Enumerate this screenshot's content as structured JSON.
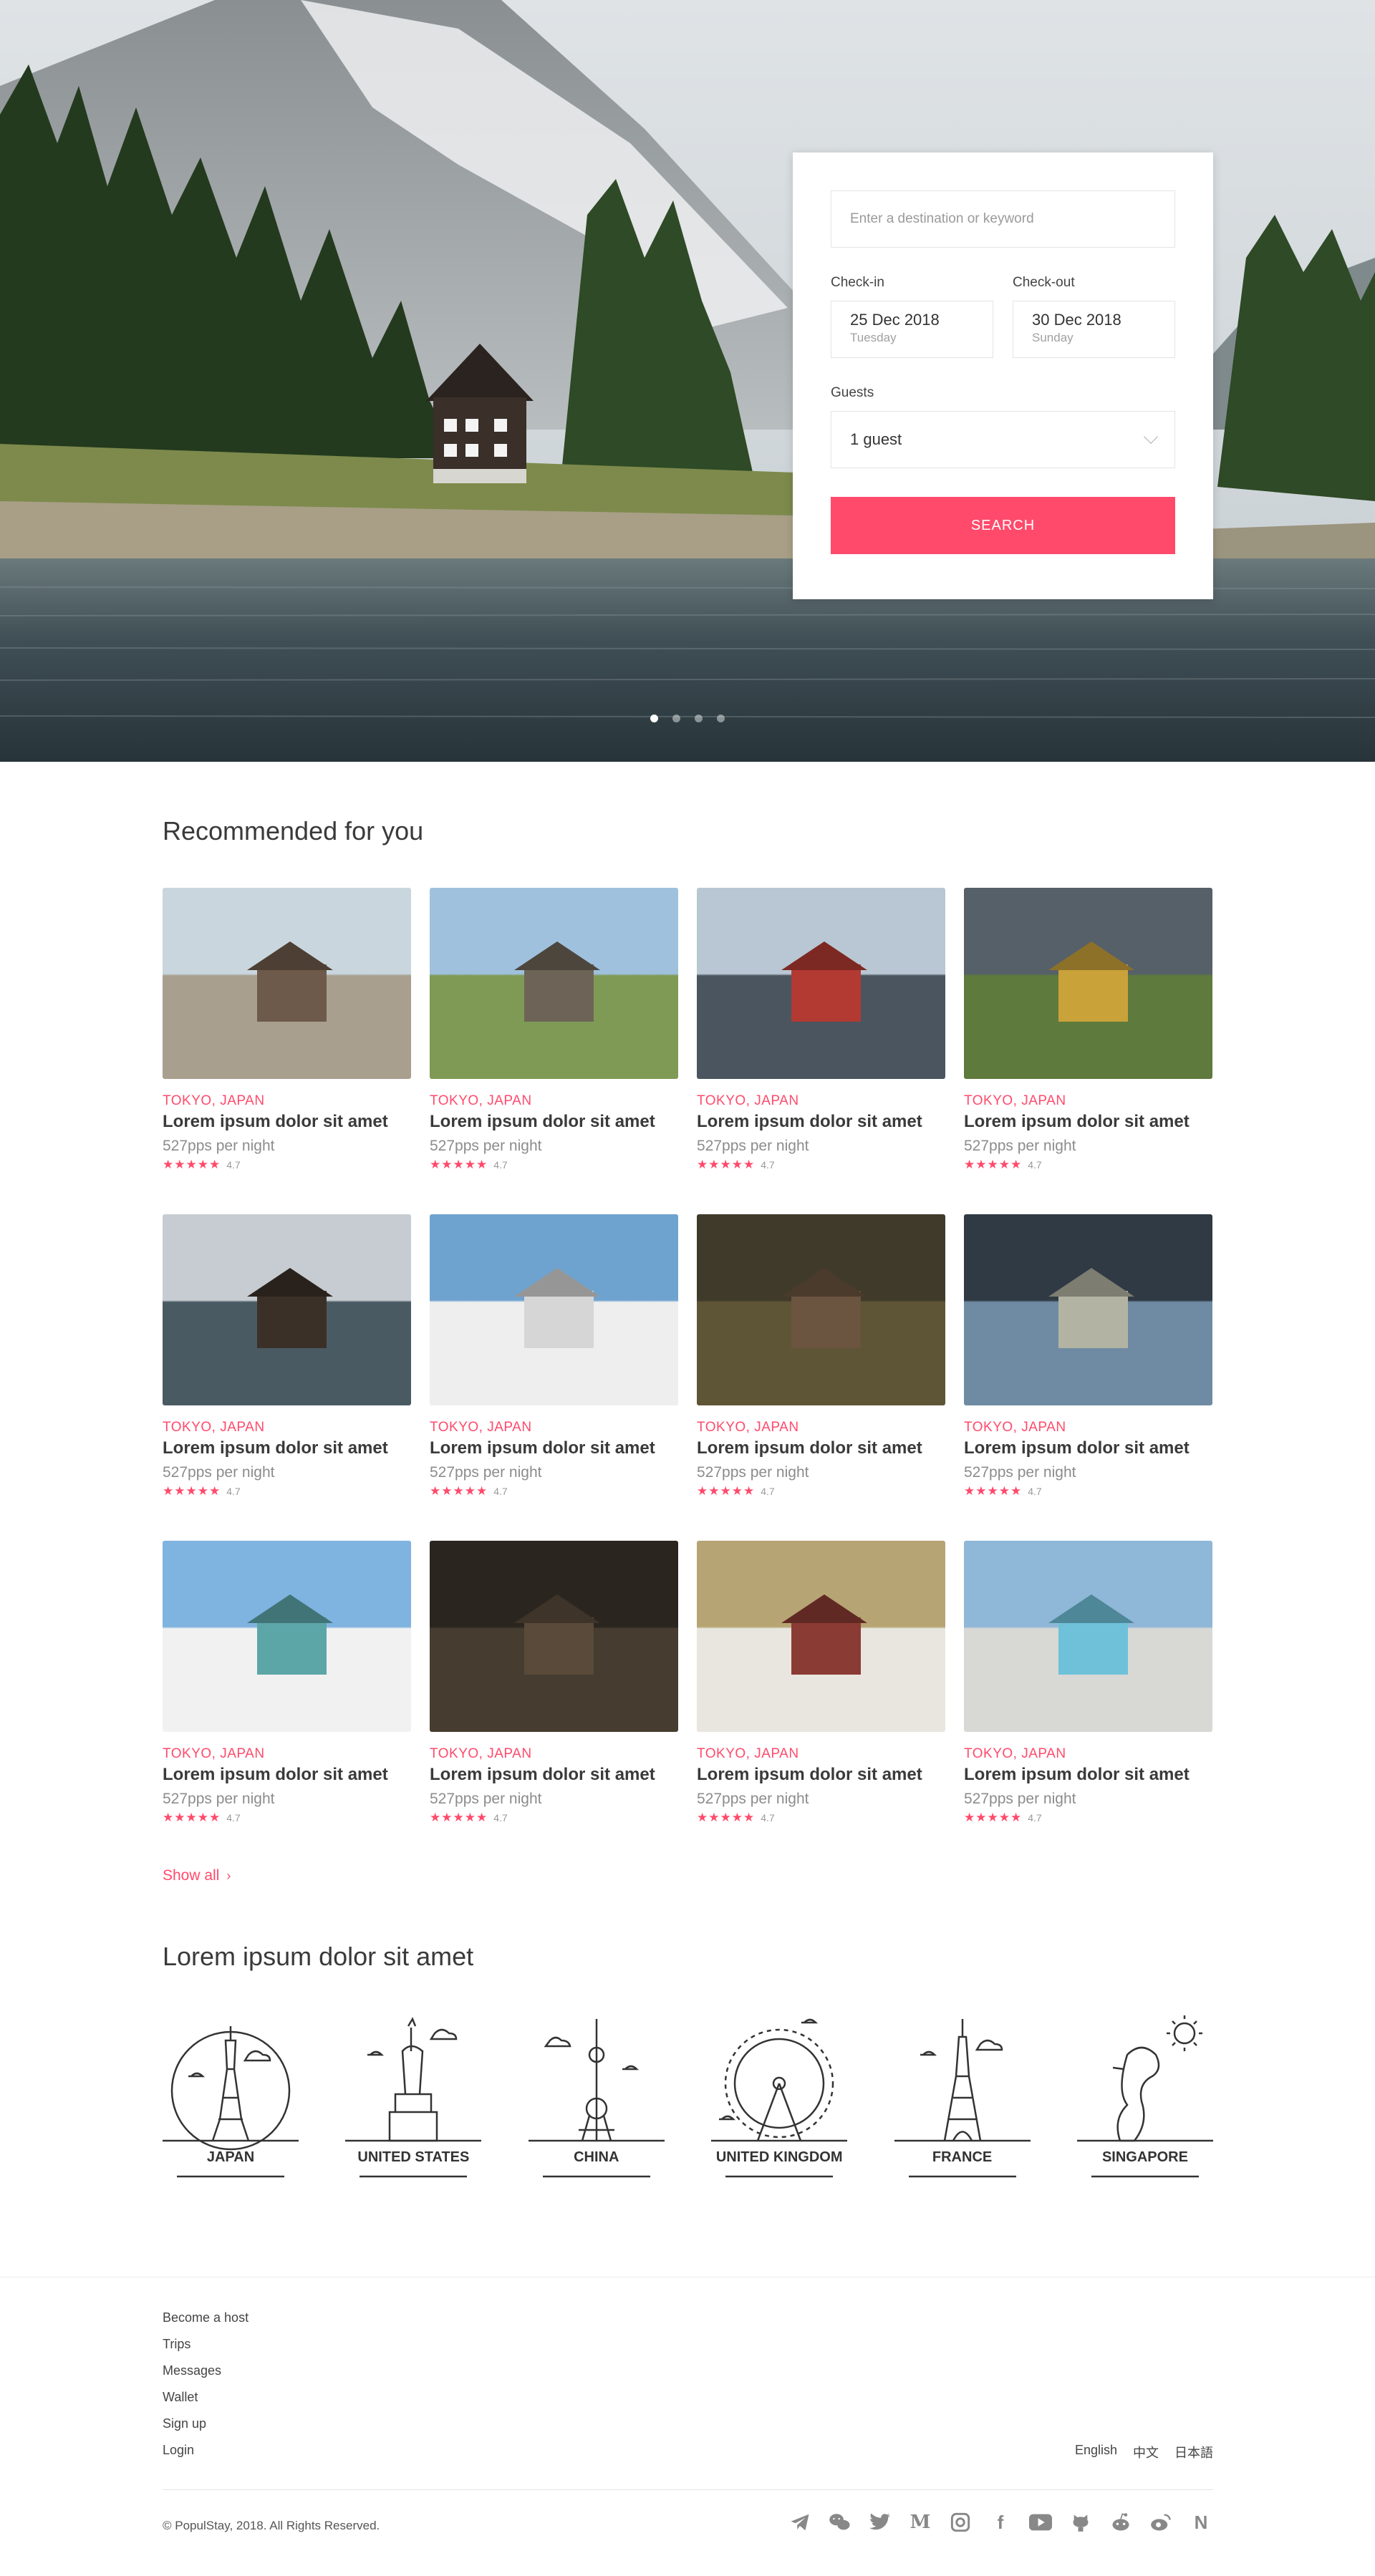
{
  "hero": {
    "carousel": {
      "slides": 4,
      "active": 1
    }
  },
  "search": {
    "destination_placeholder": "Enter a destination or keyword",
    "checkin_label": "Check-in",
    "checkin_date": "25 Dec 2018",
    "checkin_day": "Tuesday",
    "checkout_label": "Check-out",
    "checkout_date": "30 Dec 2018",
    "checkout_day": "Sunday",
    "guests_label": "Guests",
    "guests_value": "1 guest",
    "button_label": "SEARCH"
  },
  "recommended": {
    "title": "Recommended for you",
    "show_all": "Show all",
    "listings": [
      {
        "location": "TOKYO, JAPAN",
        "name": "Lorem ipsum dolor sit amet",
        "price": "527pps per night",
        "stars": "★★★★★",
        "rating": "4.7"
      },
      {
        "location": "TOKYO, JAPAN",
        "name": "Lorem ipsum dolor sit amet",
        "price": "527pps per night",
        "stars": "★★★★★",
        "rating": "4.7"
      },
      {
        "location": "TOKYO, JAPAN",
        "name": "Lorem ipsum dolor sit amet",
        "price": "527pps per night",
        "stars": "★★★★★",
        "rating": "4.7"
      },
      {
        "location": "TOKYO, JAPAN",
        "name": "Lorem ipsum dolor sit amet",
        "price": "527pps per night",
        "stars": "★★★★★",
        "rating": "4.7"
      },
      {
        "location": "TOKYO, JAPAN",
        "name": "Lorem ipsum dolor sit amet",
        "price": "527pps per night",
        "stars": "★★★★★",
        "rating": "4.7"
      },
      {
        "location": "TOKYO, JAPAN",
        "name": "Lorem ipsum dolor sit amet",
        "price": "527pps per night",
        "stars": "★★★★★",
        "rating": "4.7"
      },
      {
        "location": "TOKYO, JAPAN",
        "name": "Lorem ipsum dolor sit amet",
        "price": "527pps per night",
        "stars": "★★★★★",
        "rating": "4.7"
      },
      {
        "location": "TOKYO, JAPAN",
        "name": "Lorem ipsum dolor sit amet",
        "price": "527pps per night",
        "stars": "★★★★★",
        "rating": "4.7"
      },
      {
        "location": "TOKYO, JAPAN",
        "name": "Lorem ipsum dolor sit amet",
        "price": "527pps per night",
        "stars": "★★★★★",
        "rating": "4.7"
      },
      {
        "location": "TOKYO, JAPAN",
        "name": "Lorem ipsum dolor sit amet",
        "price": "527pps per night",
        "stars": "★★★★★",
        "rating": "4.7"
      },
      {
        "location": "TOKYO, JAPAN",
        "name": "Lorem ipsum dolor sit amet",
        "price": "527pps per night",
        "stars": "★★★★★",
        "rating": "4.7"
      },
      {
        "location": "TOKYO, JAPAN",
        "name": "Lorem ipsum dolor sit amet",
        "price": "527pps per night",
        "stars": "★★★★★",
        "rating": "4.7"
      }
    ]
  },
  "destinations": {
    "title": "Lorem ipsum dolor sit amet",
    "items": [
      {
        "name": "JAPAN",
        "icon": "tokyo-tower-icon"
      },
      {
        "name": "UNITED STATES",
        "icon": "statue-of-liberty-icon"
      },
      {
        "name": "CHINA",
        "icon": "oriental-pearl-tower-icon"
      },
      {
        "name": "UNITED KINGDOM",
        "icon": "london-eye-icon"
      },
      {
        "name": "FRANCE",
        "icon": "eiffel-tower-icon"
      },
      {
        "name": "SINGAPORE",
        "icon": "merlion-icon"
      }
    ]
  },
  "footer": {
    "links": [
      "Become a host",
      "Trips",
      "Messages",
      "Wallet",
      "Sign up",
      "Login"
    ],
    "languages": [
      "English",
      "中文",
      "日本語"
    ],
    "copyright": "© PopulStay, 2018. All Rights Reserved.",
    "socials": [
      "telegram-icon",
      "wechat-icon",
      "twitter-icon",
      "medium-icon",
      "instagram-icon",
      "facebook-icon",
      "youtube-icon",
      "github-icon",
      "reddit-icon",
      "weibo-icon",
      "naver-icon"
    ]
  },
  "colors": {
    "accent": "#ff4a6b",
    "text": "#3a3a3a",
    "muted": "#8c8c8c"
  }
}
